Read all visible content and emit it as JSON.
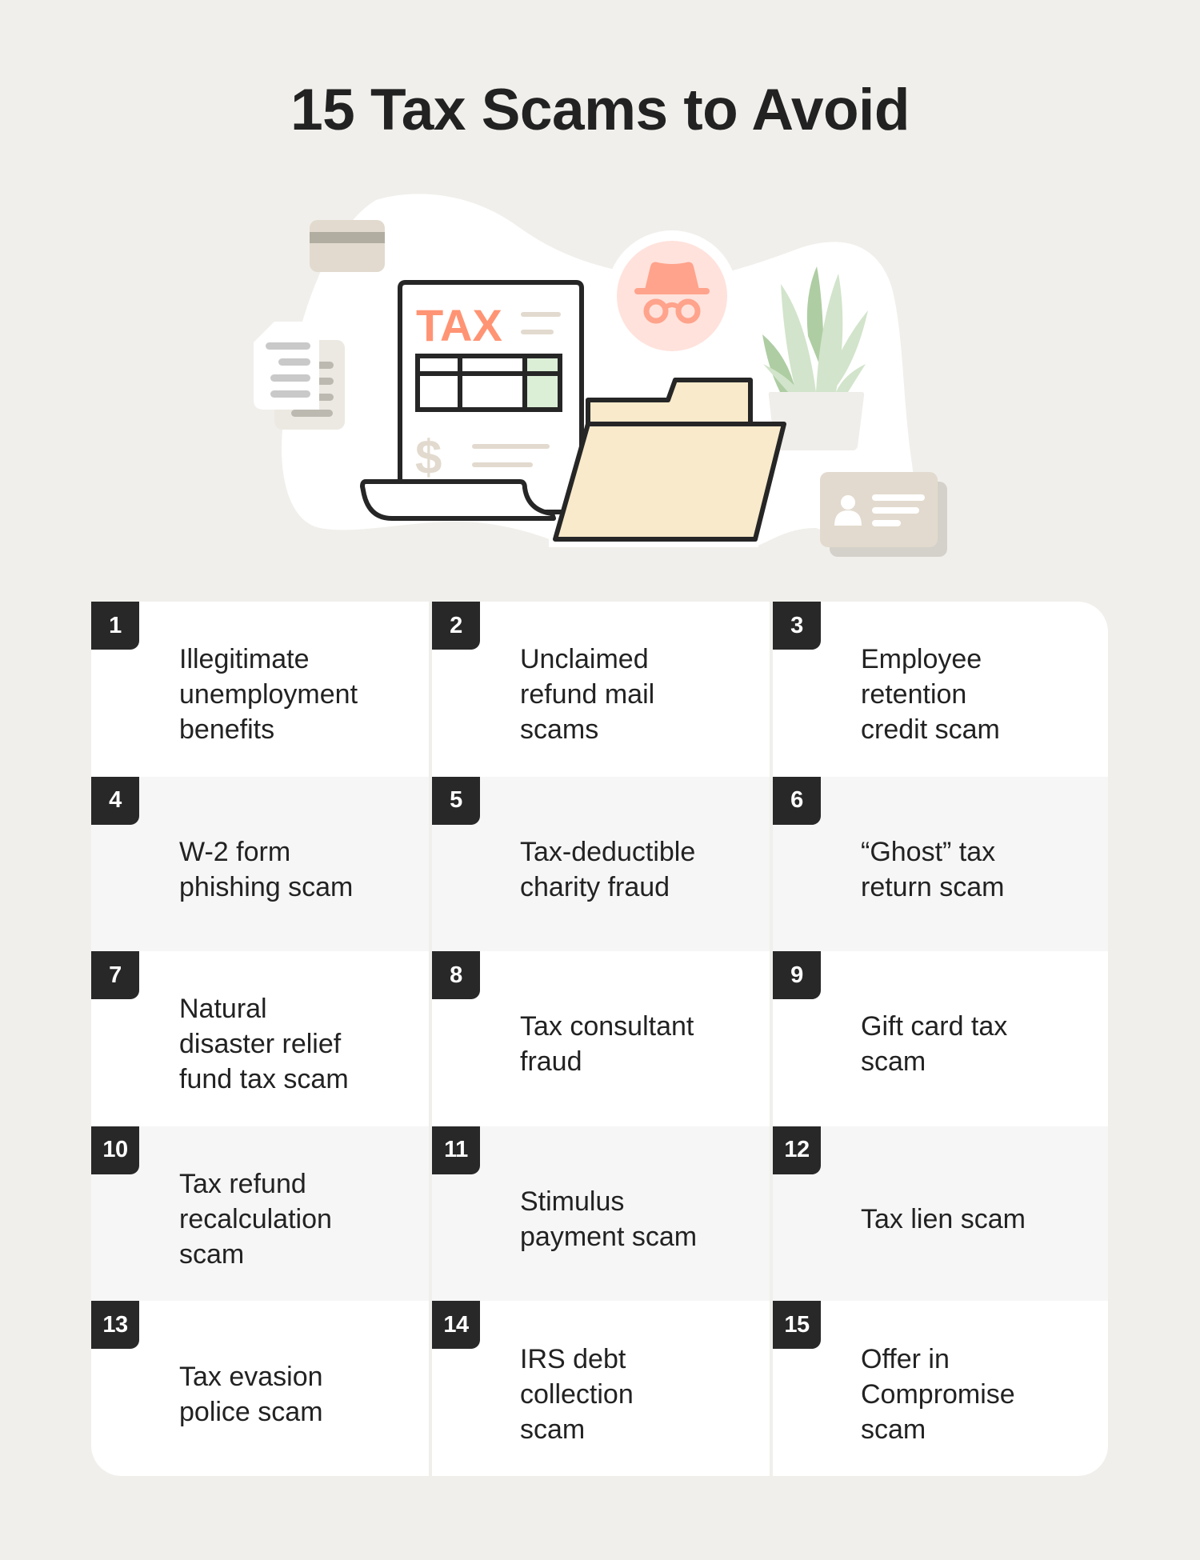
{
  "page": {
    "title": "15 Tax Scams to Avoid",
    "background": "#f0efeb"
  },
  "illustration": {
    "document_heading": "TAX",
    "document_symbol": "$",
    "icons": [
      "credit-card-icon",
      "paper-stack-icon",
      "tax-document-icon",
      "incognito-spy-icon",
      "folder-icon",
      "potted-plant-icon",
      "id-card-icon"
    ],
    "colors": {
      "accent": "#ff9474",
      "spy_circle": "#ffe2dc",
      "spy_glyph": "#ffa38c",
      "folder": "#f8eaca",
      "outline": "#262626",
      "beige": "#e2dace",
      "plant_light": "#d2e4cb",
      "plant_dark": "#aecda3",
      "table_highlight": "#dbeed6"
    }
  },
  "scams": [
    {
      "number": "1",
      "label": "Illegitimate\nunemployment\nbenefits"
    },
    {
      "number": "2",
      "label": "Unclaimed\nrefund mail\nscams"
    },
    {
      "number": "3",
      "label": "Employee\nretention\ncredit scam"
    },
    {
      "number": "4",
      "label": "W-2 form\nphishing scam"
    },
    {
      "number": "5",
      "label": "Tax-deductible\ncharity fraud"
    },
    {
      "number": "6",
      "label": "“Ghost” tax\nreturn scam"
    },
    {
      "number": "7",
      "label": "Natural\ndisaster relief\nfund tax scam"
    },
    {
      "number": "8",
      "label": "Tax consultant\nfraud"
    },
    {
      "number": "9",
      "label": "Gift card tax\nscam"
    },
    {
      "number": "10",
      "label": "Tax refund\nrecalculation\nscam"
    },
    {
      "number": "11",
      "label": "Stimulus\npayment scam"
    },
    {
      "number": "12",
      "label": "Tax lien scam"
    },
    {
      "number": "13",
      "label": "Tax evasion\npolice scam"
    },
    {
      "number": "14",
      "label": "IRS debt\ncollection\nscam"
    },
    {
      "number": "15",
      "label": "Offer in\nCompromise\nscam"
    }
  ]
}
